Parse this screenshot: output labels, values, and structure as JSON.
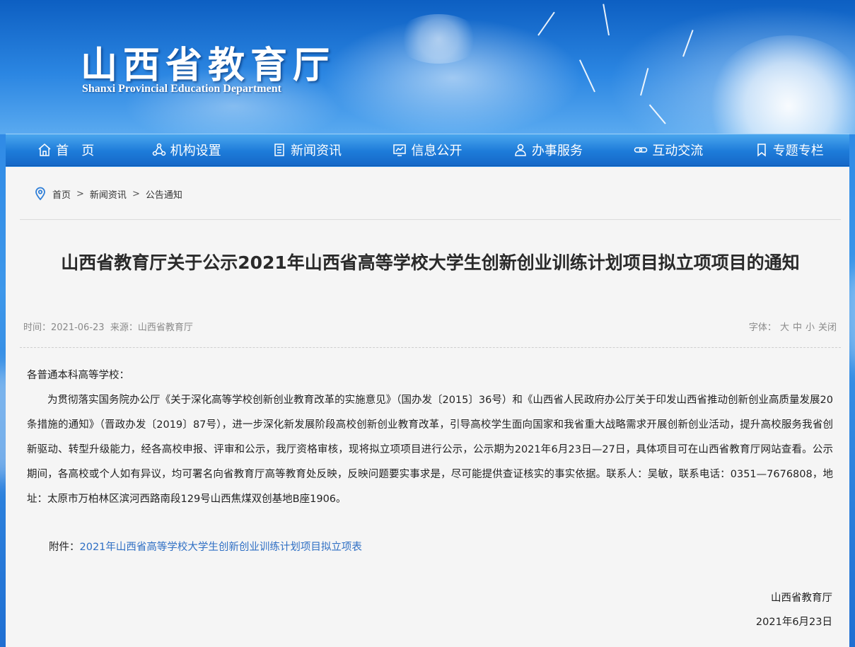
{
  "header": {
    "site_title": "山西省教育厅",
    "site_subtitle": "Shanxi Provincial Education Department"
  },
  "nav": {
    "items": [
      {
        "label": "首　页",
        "icon": "home-icon"
      },
      {
        "label": "机构设置",
        "icon": "org-icon"
      },
      {
        "label": "新闻资讯",
        "icon": "document-icon"
      },
      {
        "label": "信息公开",
        "icon": "info-icon"
      },
      {
        "label": "办事服务",
        "icon": "user-service-icon"
      },
      {
        "label": "互动交流",
        "icon": "link-icon"
      },
      {
        "label": "专题专栏",
        "icon": "bookmark-icon"
      }
    ]
  },
  "breadcrumb": {
    "icon": "location-pin-icon",
    "items": [
      "首页",
      "新闻资讯",
      "公告通知"
    ],
    "separator": ">"
  },
  "article": {
    "title": "山西省教育厅关于公示2021年山西省高等学校大学生创新创业训练计划项目拟立项项目的通知",
    "meta_time_label": "时间：",
    "meta_time": "2021-06-23",
    "meta_source_label": "来源：",
    "meta_source": "山西省教育厅",
    "font_label": "字体：",
    "font_large": "大",
    "font_medium": "中",
    "font_small": "小",
    "close_label": "关闭",
    "salutation": "各普通本科高等学校：",
    "paragraph": "为贯彻落实国务院办公厅《关于深化高等学校创新创业教育改革的实施意见》（国办发〔2015〕36号）和《山西省人民政府办公厅关于印发山西省推动创新创业高质量发展20条措施的通知》（晋政办发〔2019〕87号），进一步深化新发展阶段高校创新创业教育改革，引导高校学生面向国家和我省重大战略需求开展创新创业活动，提升高校服务我省创新驱动、转型升级能力，经各高校申报、评审和公示，我厅资格审核，现将拟立项项目进行公示，公示期为2021年6月23日—27日，具体项目可在山西省教育厅网站查看。公示期间，各高校或个人如有异议，均可署名向省教育厅高等教育处反映，反映问题要实事求是，尽可能提供查证核实的事实依据。联系人：吴敏，联系电话：0351—7676808，地址：太原市万柏林区滨河西路南段129号山西焦煤双创基地B座1906。",
    "attachment_label": "附件：",
    "attachment_link": "2021年山西省高等学校大学生创新创业训练计划项目拟立项表",
    "signature_org": "山西省教育厅",
    "signature_date": "2021年6月23日"
  },
  "colors": {
    "nav_bg": "#1d7bd9",
    "link": "#2f6fc4",
    "content_bg": "#f5f5f5",
    "meta_text": "#8a8a8a"
  }
}
